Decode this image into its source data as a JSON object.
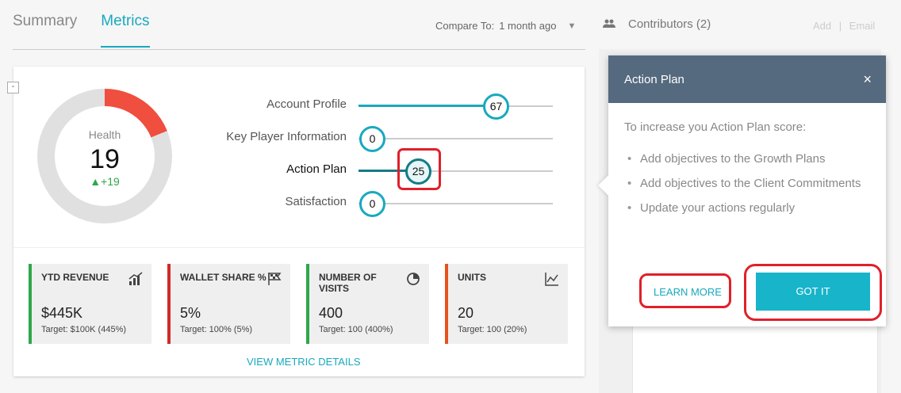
{
  "tabs": [
    {
      "label": "Summary",
      "active": false
    },
    {
      "label": "Metrics",
      "active": true
    }
  ],
  "compare": {
    "label": "Compare To:",
    "value": "1 month ago"
  },
  "contributors": {
    "label": "Contributors (2)",
    "add": "Add",
    "separator": "|",
    "email": "Email"
  },
  "collapse_symbol": "-",
  "health": {
    "label": "Health",
    "value": "19",
    "delta": "▲+19",
    "score_fraction": 0.19
  },
  "metrics": [
    {
      "label": "Account Profile",
      "value": "67"
    },
    {
      "label": "Key Player Information",
      "value": "0"
    },
    {
      "label": "Action Plan",
      "value": "25"
    },
    {
      "label": "Satisfaction",
      "value": "0"
    }
  ],
  "kpis": [
    {
      "title": "YTD REVENUE",
      "value": "$445K",
      "target": "Target: $100K (445%)",
      "icon": "bar-chart-icon",
      "color": "#2ea84a"
    },
    {
      "title": "WALLET SHARE %",
      "value": "5%",
      "target": "Target: 100% (5%)",
      "icon": "flag-icon",
      "color": "#d02a2a"
    },
    {
      "title": "NUMBER OF VISITS",
      "value": "400",
      "target": "Target: 100 (400%)",
      "icon": "pie-chart-icon",
      "color": "#2ea84a"
    },
    {
      "title": "UNITS",
      "value": "20",
      "target": "Target: 100 (20%)",
      "icon": "line-chart-icon",
      "color": "#e8501e"
    }
  ],
  "view_details": "VIEW METRIC DETAILS",
  "popover": {
    "title": "Action Plan",
    "close": "×",
    "intro": "To increase you Action Plan score:",
    "items": [
      "Add objectives to the Growth Plans",
      "Add objectives to the Client Commitments",
      "Update your actions regularly"
    ],
    "learn_more": "LEARN MORE",
    "got_it": "GOT IT"
  },
  "colors": {
    "accent": "#18a9bf",
    "danger": "#f04e3e",
    "popover_header": "#556a7e",
    "highlight": "#e0202a"
  }
}
